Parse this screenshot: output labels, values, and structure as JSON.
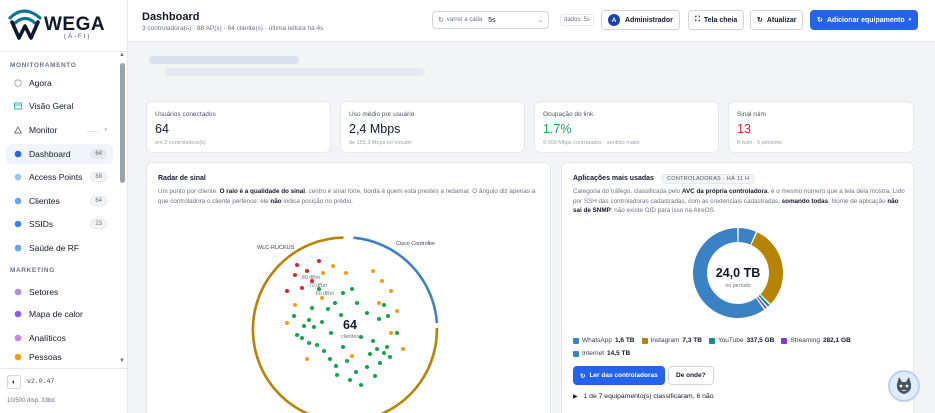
{
  "brand": {
    "name": "WEGA",
    "sub": "(A-FI)",
    "color": "#0e7490"
  },
  "sidebar": {
    "section_monitor": "MONITORAMENTO",
    "section_marketing": "MARKETING",
    "items": [
      {
        "label": "Agora",
        "icon": "clock-icon"
      },
      {
        "label": "Visão Geral",
        "icon": "overview-icon"
      },
      {
        "label": "Monitor",
        "icon": "triangle-icon",
        "extra": "......"
      },
      {
        "label": "Dashboard",
        "icon": "dashboard-icon",
        "badge": "64"
      },
      {
        "label": "Access Points",
        "icon": "access-point-icon",
        "badge": "88"
      },
      {
        "label": "Clientes",
        "icon": "client-icon",
        "badge": "64"
      },
      {
        "label": "SSIDs",
        "icon": "ssid-icon",
        "badge": "23"
      },
      {
        "label": "Saúde de RF",
        "icon": "rf-icon"
      },
      {
        "label": "Setores",
        "icon": "sector-icon"
      },
      {
        "label": "Mapa de calor",
        "icon": "heatmap-icon"
      },
      {
        "label": "Analíticos",
        "icon": "analytics-icon"
      },
      {
        "label": "Pessoas",
        "icon": "people-icon"
      }
    ],
    "version": "v2.0.47",
    "footer": "10/500 disp.  33bd"
  },
  "header": {
    "title": "Dashboard",
    "subtitle": "3 controladora(s) · 88 AP(s) · 64 cliente(s) · última leitura há 4s",
    "refresh_label": "varrer a cada",
    "refresh_value": "5s",
    "data_badge": "dados: 5s",
    "user_initial": "A",
    "user_label": "Administrador",
    "fullscreen_label": "Tela cheia",
    "update_label": "Atualizar",
    "add_label": "Adicionar equipamento"
  },
  "stats": [
    {
      "label": "Usuários conectados",
      "value": "64",
      "sub": "em 3 controladora(s)",
      "color": "#111827"
    },
    {
      "label": "Uso médio por usuário",
      "value": "2,4 Mbps",
      "sub": "de 155,3 Mbps no coculto",
      "color": "#111827"
    },
    {
      "label": "Ocupação do link",
      "value": "1.7%",
      "sub": "9.000 Mbps contratados · sentido maior",
      "color": "#16a34a"
    },
    {
      "label": "Sinal ruim",
      "value": "13",
      "sub": "8 ruim · 5 péssimo",
      "color": "#dc2626"
    }
  ],
  "radar": {
    "title": "Radar de sinal",
    "desc_1": "Um ponto por cliente.",
    "desc_2": "O raio é a qualidade do sinal",
    "desc_3": ", centro é sinal forte, borda é quem está prestes a redamar. O ângulo diz",
    "desc_4": "apenas a que controladora o cliente pertence: ele",
    "desc_5": "não",
    "desc_6": "indica posição no prédio.",
    "label_left": "WLC-RUCKUS",
    "label_right": "Cisco Controller",
    "ring_labels": [
      "-80 dBm",
      "-70 dBm",
      "-60 dBm"
    ],
    "center_value": "64",
    "center_label": "clientes",
    "colors": {
      "strong": "#16a34a",
      "medium": "#f59e0b",
      "weak": "#dc2626",
      "ring_left": "#b58405",
      "ring_right": "#3b82c4"
    }
  },
  "apps": {
    "title": "Aplicações mais usadas",
    "tag": "CONTROLADORAS · HÁ 11 H",
    "desc_1": "Categoria do tráfego, classificada pelo",
    "desc_2": "AVC da própria controladora",
    "desc_3": ", é o mesmo número que a tela dela",
    "desc_4": "mostra. Lido por SSH das controladoras cadastradas, com as credenciais cadastradas,",
    "desc_5": "somando todas",
    "desc_6": ". Nome de",
    "desc_7": "aplicação",
    "desc_8": "não sai de SNMP",
    "desc_9": ": não existe OID para isso na AireOS.",
    "total": "24,0 TB",
    "total_label": "no período",
    "legend": [
      {
        "name": "WhatsApp",
        "value": "1,6 TB",
        "color": "#3b82c4"
      },
      {
        "name": "Instagram",
        "value": "7,3 TB",
        "color": "#b58405"
      },
      {
        "name": "YouTube",
        "value": "337,5 GB",
        "color": "#0f8f8f"
      },
      {
        "name": "Streaming",
        "value": "282,1 GB",
        "color": "#7c3aed"
      },
      {
        "name": "Internet",
        "value": "14,5 TB",
        "color": "#3b82c4"
      }
    ],
    "read_button": "Ler das controladoras",
    "where_button": "De onde?",
    "classified": "1 de 7 equipamento(s) classificaram, 6 não"
  }
}
